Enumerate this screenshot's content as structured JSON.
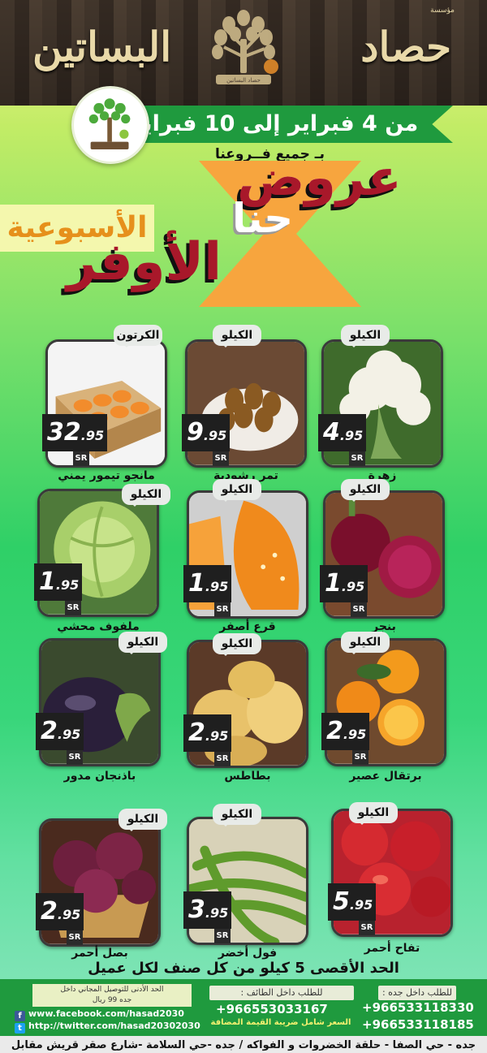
{
  "header": {
    "small_tag": "مؤسسة",
    "word_right": "حصاد",
    "word_left": "البساتين",
    "logo_caption": "حصاد البساتين"
  },
  "banner": {
    "date_range": "من 4 فبراير إلى 10 فبراير",
    "branches": "بـ جميع فــروعنا"
  },
  "headline": {
    "offers": "عروض",
    "ours": "حنا",
    "best": "الأوفر",
    "weekly": "الأسبوعية"
  },
  "currency": "SR",
  "products": [
    {
      "name": "زهرة",
      "unit": "الكيلو",
      "whole": "4",
      "decimal": ".95",
      "icon": "cauliflower"
    },
    {
      "name": "تمر رشودية",
      "unit": "الكيلو",
      "whole": "9",
      "decimal": ".95",
      "icon": "dates"
    },
    {
      "name": "مانجو تيمور يمني",
      "unit": "الكرتون",
      "whole": "32",
      "decimal": ".95",
      "icon": "mango-box"
    },
    {
      "name": "بنجر",
      "unit": "الكيلو",
      "whole": "1",
      "decimal": ".95",
      "icon": "beetroot"
    },
    {
      "name": "قرع أصفر",
      "unit": "الكيلو",
      "whole": "1",
      "decimal": ".95",
      "icon": "pumpkin"
    },
    {
      "name": "ملفوف محشي",
      "unit": "الكيلو",
      "whole": "1",
      "decimal": ".95",
      "icon": "cabbage"
    },
    {
      "name": "برتقال عصير",
      "unit": "الكيلو",
      "whole": "2",
      "decimal": ".95",
      "icon": "orange"
    },
    {
      "name": "بطاطس",
      "unit": "الكيلو",
      "whole": "2",
      "decimal": ".95",
      "icon": "potato"
    },
    {
      "name": "باذنجان مدور",
      "unit": "الكيلو",
      "whole": "2",
      "decimal": ".95",
      "icon": "eggplant"
    },
    {
      "name": "تفاح أحمر",
      "unit": "الكيلو",
      "whole": "5",
      "decimal": ".95",
      "icon": "apple"
    },
    {
      "name": "فول أخضر",
      "unit": "الكيلو",
      "whole": "3",
      "decimal": ".95",
      "icon": "green-beans"
    },
    {
      "name": "بصل أحمر",
      "unit": "الكيلو",
      "whole": "2",
      "decimal": ".95",
      "icon": "red-onion"
    }
  ],
  "footer": {
    "limit": "الحد الأقصى 5 كيلو من كل صنف لكل عميل",
    "jeddah_label": "للطلب داخل جده :",
    "jeddah_phone_1": "+966533118330",
    "jeddah_phone_2": "+966533118185",
    "taif_label": "للطلب داخل الطائف :",
    "taif_phone": "+966553033167",
    "vat_note": "السعر شامل ضريبة القيمة المضافة",
    "min_delivery_1": "الحد الأدنى للتوصيل المجاني داخل",
    "min_delivery_2": "جده 99 ريال",
    "facebook": "www.facebook.com/hasad2030",
    "twitter": "http://twitter.com/hasad20302030",
    "address": "جده - حي الصفا - حلقة الخضروات و الفواكه / جده -حي السلامة -شارع صقر قريش مقابل كودو"
  }
}
